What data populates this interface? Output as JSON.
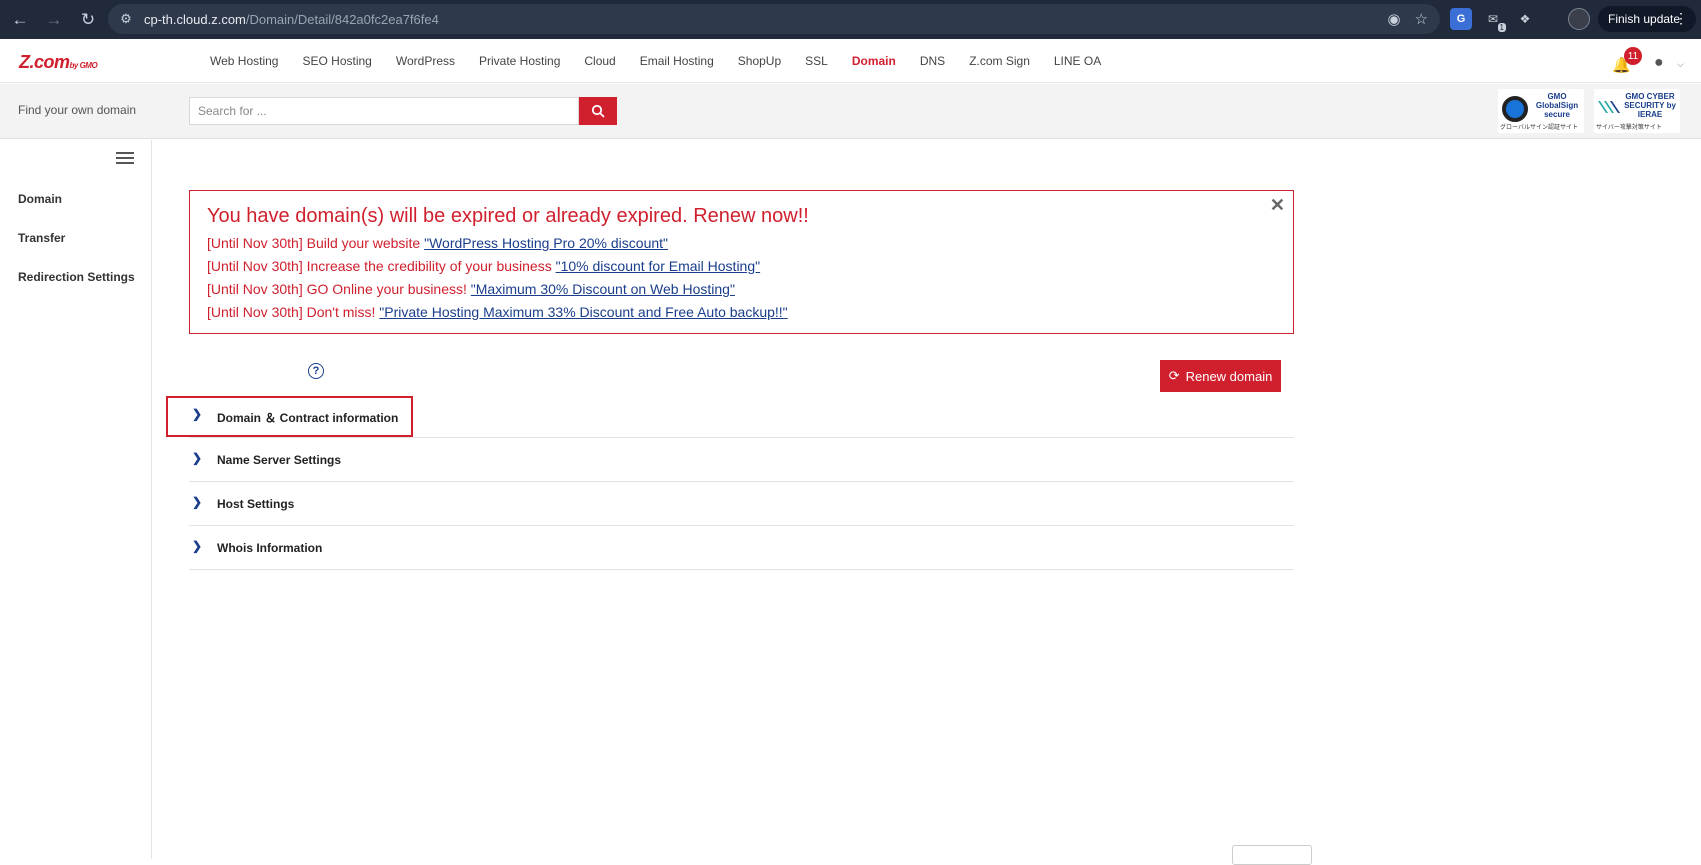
{
  "browser": {
    "url_host": "cp-th.cloud.z.com",
    "url_path": "/Domain/Detail/842a0fc2ea7f6fe4",
    "finish_update_label": "Finish update",
    "ext_badge": "1"
  },
  "header": {
    "logo_main": "Z.com",
    "logo_sub": "by GMO",
    "nav": [
      {
        "label": "Web Hosting",
        "active": false
      },
      {
        "label": "SEO Hosting",
        "active": false
      },
      {
        "label": "WordPress",
        "active": false
      },
      {
        "label": "Private Hosting",
        "active": false
      },
      {
        "label": "Cloud",
        "active": false
      },
      {
        "label": "Email Hosting",
        "active": false
      },
      {
        "label": "ShopUp",
        "active": false
      },
      {
        "label": "SSL",
        "active": false
      },
      {
        "label": "Domain",
        "active": true
      },
      {
        "label": "DNS",
        "active": false
      },
      {
        "label": "Z.com Sign",
        "active": false
      },
      {
        "label": "LINE OA",
        "active": false
      }
    ],
    "notification_count": "11"
  },
  "search": {
    "label": "Find your own domain",
    "placeholder": "Search for ..."
  },
  "badges": {
    "globalsign_title": "GMO GlobalSign secure",
    "globalsign_sub": "グローバルサイン認証サイト",
    "cyber_title": "GMO CYBER SECURITY by IERAE",
    "cyber_sub": "サイバー攻撃対策サイト"
  },
  "sidebar": {
    "items": [
      {
        "label": "Domain"
      },
      {
        "label": "Transfer"
      },
      {
        "label": "Redirection Settings"
      }
    ]
  },
  "alert": {
    "title": "You have domain(s) will be expired or already expired. Renew now!!",
    "lines": [
      {
        "prefix": "[Until Nov 30th] Build your website ",
        "link": "\"WordPress Hosting Pro 20% discount\""
      },
      {
        "prefix": "[Until Nov 30th] Increase the credibility of your business ",
        "link": "\"10% discount for Email Hosting\""
      },
      {
        "prefix": "[Until Nov 30th] GO Online your business! ",
        "link": "\"Maximum 30% Discount on Web Hosting\""
      },
      {
        "prefix": "[Until Nov 30th] Don't miss! ",
        "link": "\"Private Hosting Maximum 33% Discount and Free Auto backup!!\""
      }
    ]
  },
  "renew_button": "Renew domain",
  "accordion": [
    {
      "label": "Domain ＆ Contract information"
    },
    {
      "label": "Name Server Settings"
    },
    {
      "label": "Host Settings"
    },
    {
      "label": "Whois Information"
    }
  ]
}
